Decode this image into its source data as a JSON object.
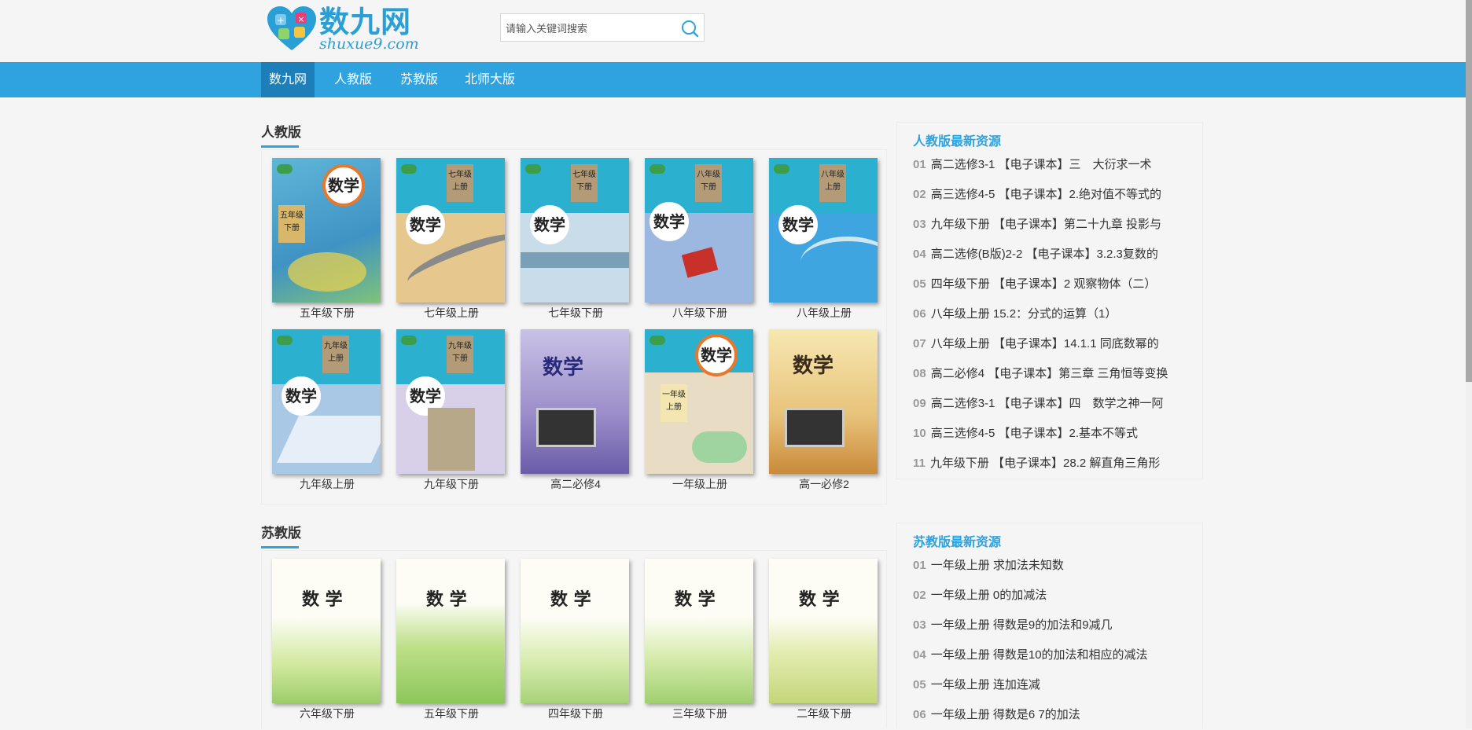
{
  "header": {
    "logo_text": "数九网",
    "logo_sub": "shuxue9.com",
    "search_placeholder": "请输入关键词搜索"
  },
  "nav": {
    "items": [
      {
        "label": "数九网",
        "active": true
      },
      {
        "label": "人教版",
        "active": false
      },
      {
        "label": "苏教版",
        "active": false
      },
      {
        "label": "北师大版",
        "active": false
      }
    ]
  },
  "renjiao": {
    "title": "人教版",
    "books": [
      {
        "caption": "五年级下册",
        "cover_title": "数学",
        "grade": "五年级",
        "sub": "下册",
        "bg": "#5fb6d8"
      },
      {
        "caption": "七年级上册",
        "cover_title": "数学",
        "grade": "七年级",
        "sub": "上册",
        "bg": "#e6c78d"
      },
      {
        "caption": "七年级下册",
        "cover_title": "数学",
        "grade": "七年级",
        "sub": "下册",
        "bg": "#c9dcea"
      },
      {
        "caption": "八年级下册",
        "cover_title": "数学",
        "grade": "八年级",
        "sub": "下册",
        "bg": "#9cb8e0"
      },
      {
        "caption": "八年级上册",
        "cover_title": "数学",
        "grade": "八年级",
        "sub": "上册",
        "bg": "#3fa5e0"
      },
      {
        "caption": "九年级上册",
        "cover_title": "数学",
        "grade": "九年级",
        "sub": "上册",
        "bg": "#a9c8e6"
      },
      {
        "caption": "九年级下册",
        "cover_title": "数学",
        "grade": "九年级",
        "sub": "下册",
        "bg": "#d7d0e8"
      },
      {
        "caption": "高二必修4",
        "cover_title": "数学",
        "grade": "",
        "sub": "",
        "bg": "#9a8cc8"
      },
      {
        "caption": "一年级上册",
        "cover_title": "数学",
        "grade": "一年级",
        "sub": "上册",
        "bg": "#e9dcc4"
      },
      {
        "caption": "高一必修2",
        "cover_title": "数学",
        "grade": "",
        "sub": "",
        "bg": "#e8c27a"
      }
    ]
  },
  "sujiao": {
    "title": "苏教版",
    "books": [
      {
        "caption": "六年级下册",
        "cover_title": "数 学"
      },
      {
        "caption": "五年级下册",
        "cover_title": "数 学"
      },
      {
        "caption": "四年级下册",
        "cover_title": "数 学"
      },
      {
        "caption": "三年级下册",
        "cover_title": "数 学"
      },
      {
        "caption": "二年级下册",
        "cover_title": "数 学"
      }
    ]
  },
  "sidebar_renjiao": {
    "title": "人教版最新资源",
    "items": [
      {
        "num": "01",
        "text": "高二选修3-1 【电子课本】三　大衍求一术"
      },
      {
        "num": "02",
        "text": "高三选修4-5 【电子课本】2.绝对值不等式的"
      },
      {
        "num": "03",
        "text": "九年级下册 【电子课本】第二十九章 投影与"
      },
      {
        "num": "04",
        "text": "高二选修(B版)2-2 【电子课本】3.2.3复数的"
      },
      {
        "num": "05",
        "text": "四年级下册 【电子课本】2 观察物体（二）"
      },
      {
        "num": "06",
        "text": "八年级上册 15.2：分式的运算（1）"
      },
      {
        "num": "07",
        "text": "八年级上册 【电子课本】14.1.1 同底数幂的"
      },
      {
        "num": "08",
        "text": "高二必修4 【电子课本】第三章 三角恒等变换"
      },
      {
        "num": "09",
        "text": "高二选修3-1 【电子课本】四　数学之神一阿"
      },
      {
        "num": "10",
        "text": "高三选修4-5 【电子课本】2.基本不等式"
      },
      {
        "num": "11",
        "text": "九年级下册 【电子课本】28.2 解直角三角形"
      }
    ]
  },
  "sidebar_sujiao": {
    "title": "苏教版最新资源",
    "items": [
      {
        "num": "01",
        "text": "一年级上册 求加法未知数"
      },
      {
        "num": "02",
        "text": "一年级上册 0的加减法"
      },
      {
        "num": "03",
        "text": "一年级上册 得数是9的加法和9减几"
      },
      {
        "num": "04",
        "text": "一年级上册 得数是10的加法和相应的减法"
      },
      {
        "num": "05",
        "text": "一年级上册 连加连减"
      },
      {
        "num": "06",
        "text": "一年级上册 得数是6 7的加法"
      }
    ]
  },
  "colors": {
    "accent": "#2fa3df",
    "nav_active": "#1c7fba"
  },
  "icons": {
    "search": "search-icon",
    "logo": "puzzle-heart-icon"
  }
}
